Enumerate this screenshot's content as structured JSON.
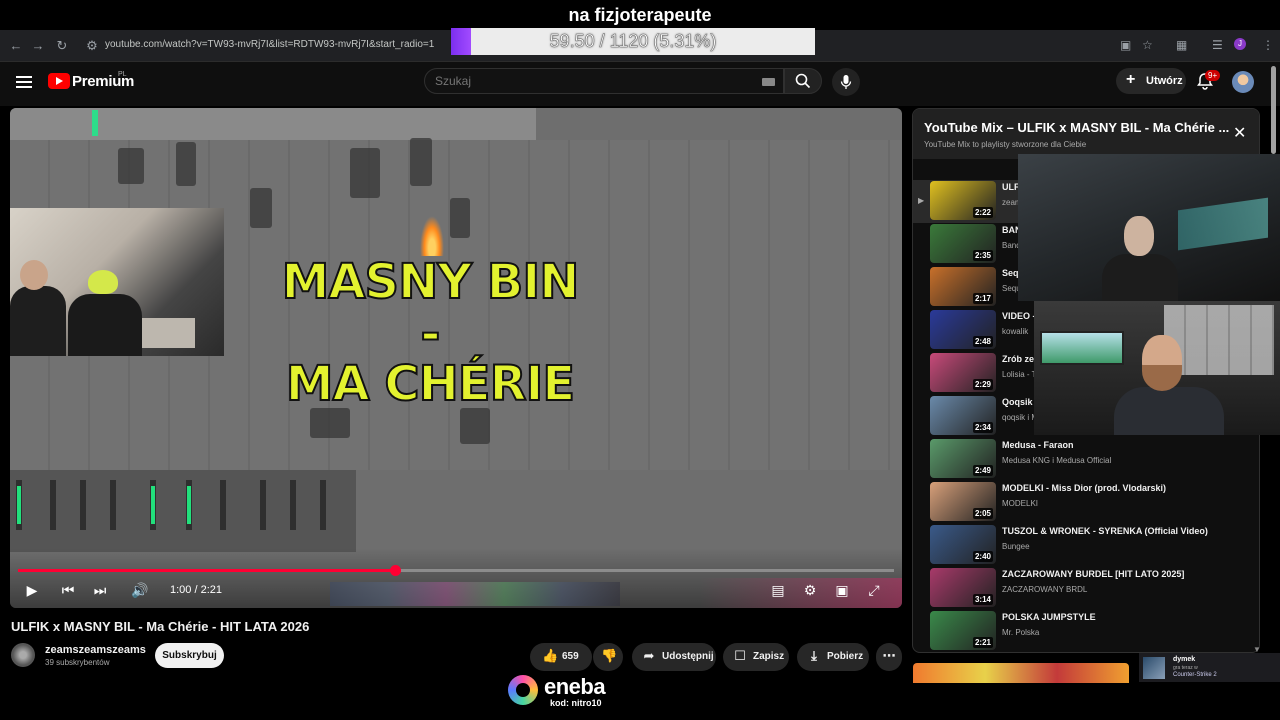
{
  "overlay": {
    "stream_title": "na fizjoterapeute",
    "goal_text": "59.50 / 1120 (5.31%)",
    "goal_fraction": 0.0531
  },
  "browser": {
    "url": "youtube.com/watch?v=TW93-mvRj7I&list=RDTW93-mvRj7I&start_radio=1",
    "back_icon": "back-arrow-icon",
    "forward_icon": "forward-arrow-icon",
    "reload_icon": "reload-icon"
  },
  "header": {
    "brand": "Premium",
    "brand_region": "PL",
    "search_placeholder": "Szukaj",
    "create_label": "Utwórz",
    "notification_count": "9+"
  },
  "player": {
    "overlay_line1": "MASNY BIN",
    "overlay_line2": "-",
    "overlay_line3": "MA CHÉRIE",
    "time": "1:00 / 2:21",
    "progress_fraction": 0.43,
    "accent": "#ff0033"
  },
  "video": {
    "title": "ULFIK x MASNY BIL - Ma Chérie - HIT LATA 2026",
    "channel": "zeamszeamszeams",
    "subscribers": "39 subskrybentów",
    "subscribe_label": "Subskrybuj",
    "likes": "659",
    "share_label": "Udostępnij",
    "save_label": "Zapisz",
    "download_label": "Pobierz"
  },
  "playlist": {
    "title": "YouTube Mix – ULFIK x MASNY BIL - Ma Chérie ...",
    "subtitle": "YouTube Mix to playlisty stworzone dla Ciebie",
    "items": [
      {
        "title": "ULFI",
        "author": "zeam",
        "duration": "2:22",
        "active": true,
        "thumb": "#e0c020"
      },
      {
        "title": "BAN Stra",
        "author": "Band",
        "duration": "2:35",
        "thumb": "#3a7a3a"
      },
      {
        "title": "Seq Tele",
        "author": "Sequento",
        "duration": "2:17",
        "thumb": "#c8702a"
      },
      {
        "title": "VIDEO - K",
        "author": "kowalik",
        "duration": "2:48",
        "thumb": "#2a3a9a"
      },
      {
        "title": "Zrób ze m",
        "author": "Lolisia - To",
        "duration": "2:29",
        "thumb": "#c84a7a"
      },
      {
        "title": "Qoqsik fi",
        "author": "qoqsik i M",
        "duration": "2:34",
        "thumb": "#6a8aaa"
      },
      {
        "title": "Medusa - Faraon",
        "author": "Medusa KNG i Medusa Official",
        "duration": "2:49",
        "thumb": "#5a9a6a"
      },
      {
        "title": "MODELKI - Miss Dior (prod. Vlodarski)",
        "author": "MODELKI",
        "duration": "2:05",
        "thumb": "#d8a07a"
      },
      {
        "title": "TUSZOL & WRONEK - SYRENKA (Official Video)",
        "author": "Bungee",
        "duration": "2:40",
        "thumb": "#3a5a8a"
      },
      {
        "title": "ZACZAROWANY BURDEL [HIT LATO 2025]",
        "author": "ZACZAROWANY BRDL",
        "duration": "3:14",
        "thumb": "#a83a6a"
      },
      {
        "title": "POLSKA JUMPSTYLE",
        "author": "Mr. Polska",
        "duration": "2:21",
        "thumb": "#3a8a4a"
      }
    ]
  },
  "promo": {
    "name": "eneba",
    "code": "kod: nitro10"
  },
  "notification": {
    "user": "dymek",
    "status": "gra teraz w",
    "game": "Counter-Strike 2"
  }
}
